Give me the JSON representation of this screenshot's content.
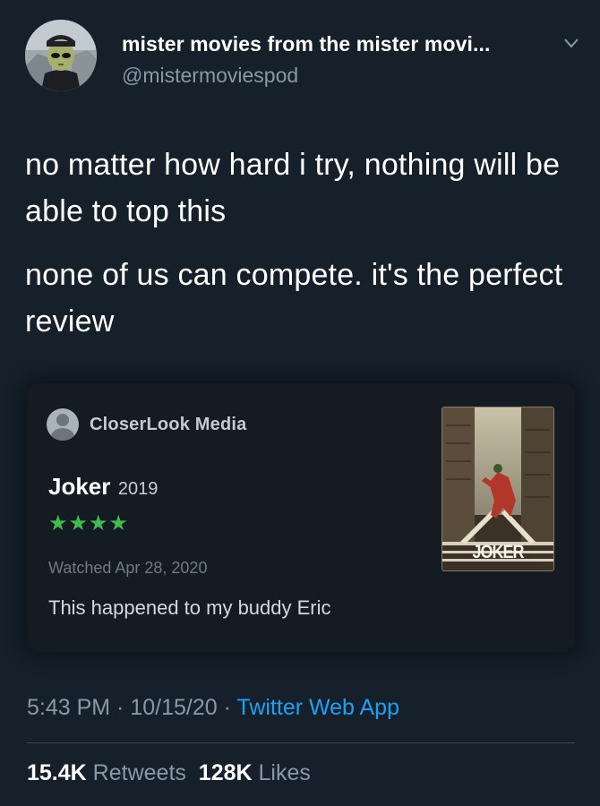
{
  "author": {
    "display_name": "mister movies from the mister movi...",
    "handle": "@mistermoviespod",
    "avatar_icon": "alien-avatar-icon",
    "menu_icon": "chevron-down-icon"
  },
  "tweet": {
    "paragraphs": [
      "no matter how hard i try, nothing will be able to top this",
      "none of us can compete. it's the perfect review"
    ]
  },
  "review_card": {
    "reviewer": "CloserLook Media",
    "film_title": "Joker",
    "film_year": "2019",
    "rating_stars": "★★★★",
    "rating": 4,
    "watched": "Watched Apr 28, 2020",
    "review_text": "This happened to my buddy Eric",
    "poster_title": "JOKER"
  },
  "meta": {
    "time": "5:43 PM",
    "separator": " · ",
    "date": "10/15/20",
    "source": "Twitter Web App"
  },
  "stats": {
    "retweets_count": "15.4K",
    "retweets_label": "Retweets",
    "likes_count": "128K",
    "likes_label": "Likes"
  },
  "colors": {
    "background": "#15202b",
    "secondary_text": "#8899a6",
    "link": "#1da1f2",
    "star_green": "#40bc4f"
  }
}
